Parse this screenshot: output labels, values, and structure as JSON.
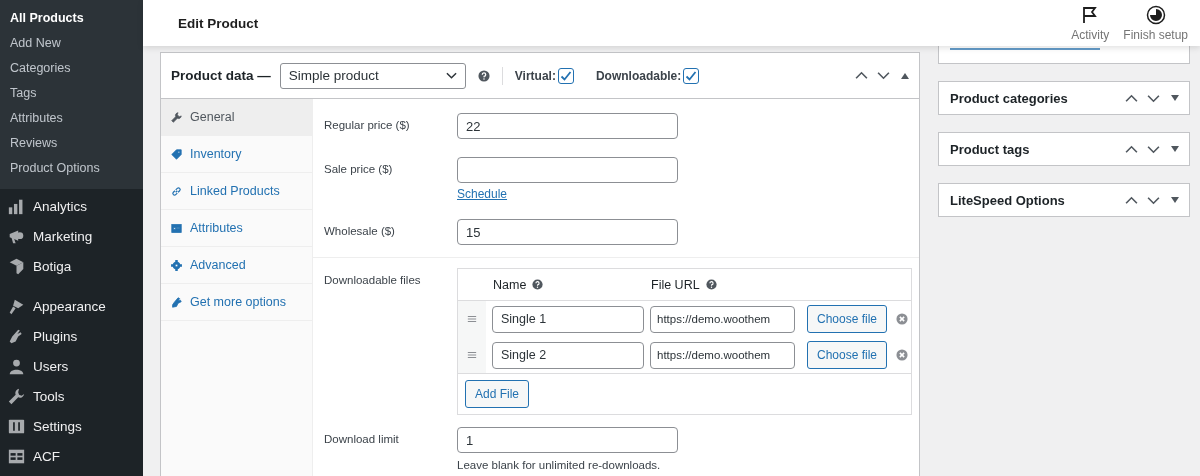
{
  "sidebar": {
    "submenu": [
      {
        "label": "All Products",
        "selected": true
      },
      {
        "label": "Add New",
        "selected": false
      },
      {
        "label": "Categories",
        "selected": false
      },
      {
        "label": "Tags",
        "selected": false
      },
      {
        "label": "Attributes",
        "selected": false
      },
      {
        "label": "Reviews",
        "selected": false
      },
      {
        "label": "Product Options",
        "selected": false
      }
    ],
    "menu_groups": [
      [
        {
          "label": "Analytics"
        },
        {
          "label": "Marketing"
        },
        {
          "label": "Botiga"
        }
      ],
      [
        {
          "label": "Appearance"
        },
        {
          "label": "Plugins"
        },
        {
          "label": "Users"
        },
        {
          "label": "Tools"
        },
        {
          "label": "Settings"
        },
        {
          "label": "ACF"
        }
      ]
    ]
  },
  "header": {
    "title": "Edit Product",
    "actions": [
      {
        "label": "Activity"
      },
      {
        "label": "Finish setup"
      }
    ]
  },
  "product_data": {
    "title": "Product data —",
    "product_type": "Simple product",
    "options": [
      {
        "label": "Virtual:",
        "checked": true
      },
      {
        "label": "Downloadable:",
        "checked": true
      }
    ],
    "tabs": [
      {
        "label": "General",
        "selected": true
      },
      {
        "label": "Inventory",
        "selected": false
      },
      {
        "label": "Linked Products",
        "selected": false
      },
      {
        "label": "Attributes",
        "selected": false
      },
      {
        "label": "Advanced",
        "selected": false
      },
      {
        "label": "Get more options",
        "selected": false
      }
    ],
    "price_fields": [
      {
        "label": "Regular price ($)",
        "value": "22"
      },
      {
        "label": "Sale price ($)",
        "link": "Schedule"
      },
      {
        "label": "Wholesale ($)",
        "value": "15"
      }
    ],
    "downloads": {
      "label": "Downloadable files",
      "columns": [
        "Name",
        "File URL"
      ],
      "files": [
        {
          "name": "Single 1",
          "url": "https://demo.woothem",
          "button": "Choose file"
        },
        {
          "name": "Single 2",
          "url": "https://demo.woothem",
          "button": "Choose file"
        }
      ],
      "add_button": "Add File"
    },
    "download_limit": {
      "label": "Download limit",
      "value": "1",
      "hint": "Leave blank for unlimited re-downloads."
    }
  },
  "side_boxes": [
    {
      "title": "Product categories"
    },
    {
      "title": "Product tags"
    },
    {
      "title": "LiteSpeed Options"
    }
  ]
}
